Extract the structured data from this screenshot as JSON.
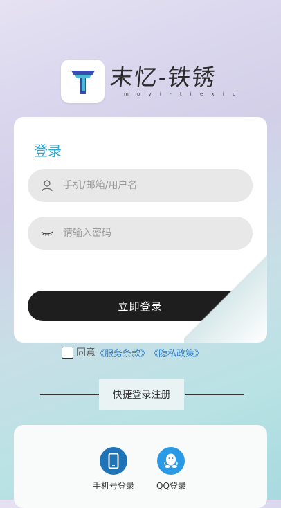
{
  "brand": {
    "name": "末忆-铁锈",
    "subtitle": "m o y i - t i e x i u"
  },
  "login": {
    "title": "登录",
    "account_placeholder": "手机/邮箱/用户名",
    "password_placeholder": "请输入密码",
    "submit_label": "立即登录"
  },
  "agreement": {
    "prefix": "同意",
    "terms": "《服务条款》",
    "privacy": "《隐私政策》",
    "checked": false
  },
  "quick_section": {
    "label": "快捷登录注册",
    "items": [
      {
        "label": "手机号登录",
        "icon": "phone-icon",
        "color": "#1f73b7"
      },
      {
        "label": "QQ登录",
        "icon": "qq-icon",
        "color": "#2a9ae6"
      }
    ]
  },
  "colors": {
    "accent": "#29a7cf",
    "button": "#1e1e1e",
    "link": "#2d7bc8"
  }
}
